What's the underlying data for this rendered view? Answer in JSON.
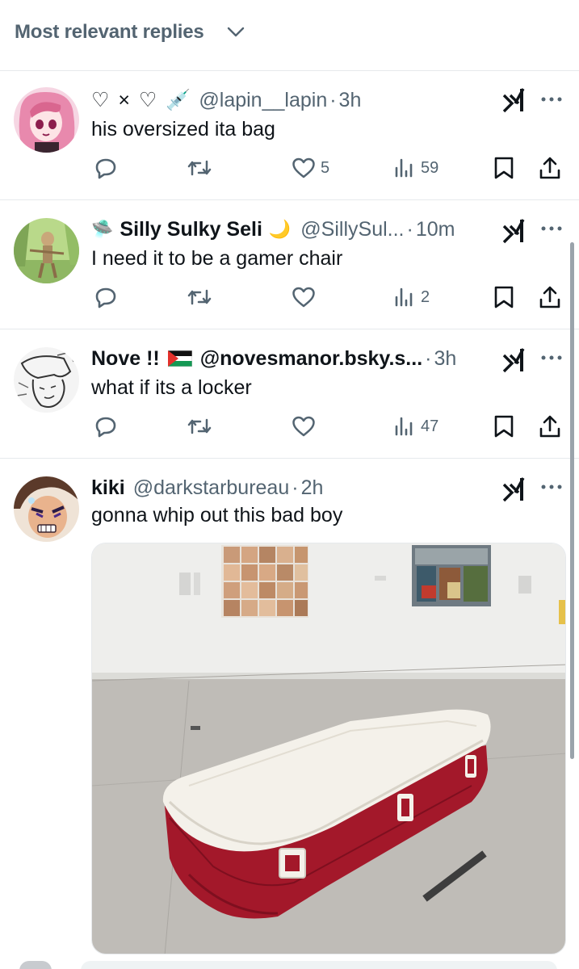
{
  "sort": {
    "label": "Most relevant replies"
  },
  "colors": {
    "text": "#0f1419",
    "muted": "#536471",
    "divider": "#e6e9ec",
    "cooler_red": "#a3182a",
    "cooler_lid": "#f4f1ea"
  },
  "replies": [
    {
      "name_emoji": "♡ × ♡ 💉",
      "name": "",
      "handle": "@lapin__lapin",
      "dot": "·",
      "time": "3h",
      "text": "his oversized ita bag",
      "likes": "5",
      "views": "59"
    },
    {
      "name_emoji": "🛸",
      "name": "Silly Sulky Seli",
      "name_suffix": "🌙",
      "handle": "@SillySul...",
      "dot": "·",
      "time": "10m",
      "text": "I need it to be a gamer chair",
      "likes": "",
      "views": "2"
    },
    {
      "name": "Nove !!",
      "name_suffix": "🇵🇸",
      "handle": "@novesmanor.bsky.s...",
      "dot": "·",
      "time": "3h",
      "text": "what if its a locker",
      "likes": "",
      "views": "47"
    },
    {
      "name": "kiki",
      "handle": "@darkstarbureau",
      "dot": "·",
      "time": "2h",
      "text": "gonna whip out this bad boy",
      "media": "photo of a red and white coffin-shaped cooler on a gallery floor"
    }
  ],
  "icons": {
    "reply": "reply-icon",
    "repost": "repost-icon",
    "like": "heart-icon",
    "views": "views-icon",
    "bookmark": "bookmark-icon",
    "share": "share-icon",
    "grok": "grok-icon",
    "more": "more-icon"
  }
}
